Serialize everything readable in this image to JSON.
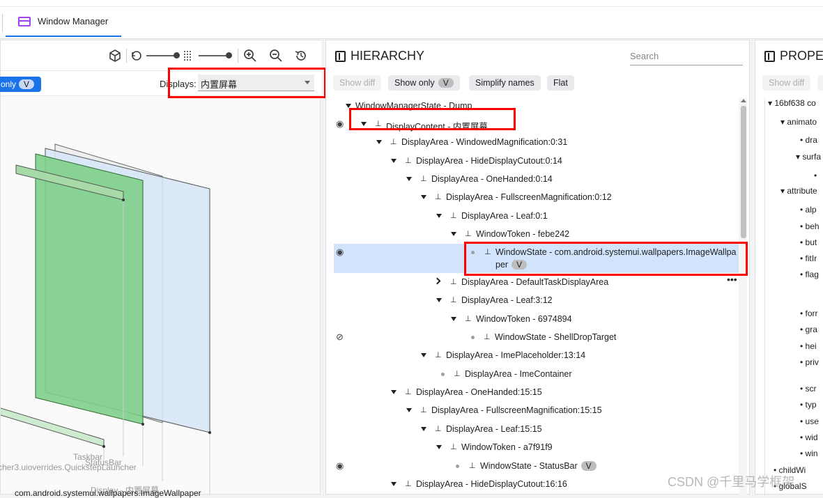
{
  "tabbar": {
    "tab_label": "Window Manager",
    "tab_icon": "window-manager-icon"
  },
  "left_panel": {
    "toolbar_icons": [
      "cube-icon",
      "rotate-icon",
      "spacing-icon",
      "zoom-in-icon",
      "zoom-out-icon",
      "reset-icon"
    ],
    "pill_label": "only",
    "pill_badge": "V",
    "displays_label": "Displays:",
    "displays_value": "内置屏幕",
    "rect_labels": {
      "taskbar": "Taskbar",
      "statusbar": "StatusBar",
      "launcher": "cher3.uioverrides.QuickstepLauncher",
      "display": "Display - 内置屏幕",
      "wallpaper": "com.android.systemui.wallpapers.ImageWallpaper"
    }
  },
  "hierarchy": {
    "title": "HIERARCHY",
    "search_placeholder": "Search",
    "buttons": {
      "show_diff": "Show diff",
      "show_only": "Show only",
      "show_only_badge": "V",
      "simplify": "Simplify names",
      "flat": "Flat"
    },
    "rows": [
      "WindowManagerState - Dump",
      "DisplayContent - 内置屏幕",
      "DisplayArea - WindowedMagnification:0:31",
      "DisplayArea - HideDisplayCutout:0:14",
      "DisplayArea - OneHanded:0:14",
      "DisplayArea - FullscreenMagnification:0:12",
      "DisplayArea - Leaf:0:1",
      "WindowToken - febe242",
      "WindowState - com.android.systemui.wallpapers.ImageWallpa",
      "per",
      "DisplayArea - DefaultTaskDisplayArea",
      "DisplayArea - Leaf:3:12",
      "WindowToken - 6974894",
      "WindowState - ShellDropTarget",
      "DisplayArea - ImePlaceholder:13:14",
      "DisplayArea - ImeContainer",
      "DisplayArea - OneHanded:15:15",
      "DisplayArea - FullscreenMagnification:15:15",
      "DisplayArea - Leaf:15:15",
      "WindowToken - a7f91f9",
      "WindowState - StatusBar",
      "DisplayArea - HideDisplayCutout:16:16"
    ],
    "badge_v": "V",
    "more": "•••"
  },
  "properties": {
    "title": "PROPE",
    "show_diff": "Show diff",
    "items": [
      "16bf638 co",
      "animato",
      "dra",
      "surfa",
      "attribute",
      "alp",
      "beh",
      "but",
      "fitIr",
      "flag",
      "forr",
      "gra",
      "hei",
      "priv",
      "scr",
      "typ",
      "use",
      "wid",
      "win",
      "childWi",
      "globalS"
    ]
  },
  "watermark": "CSDN @千里马学框架"
}
